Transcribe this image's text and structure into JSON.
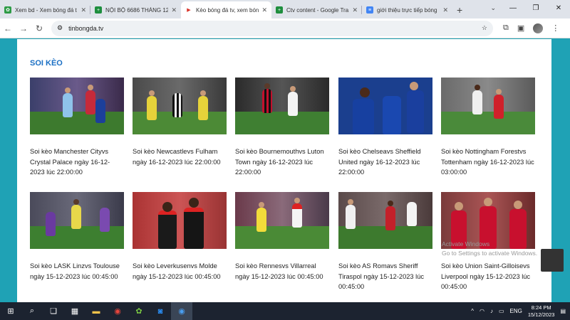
{
  "browser": {
    "tabs": [
      {
        "label": "Xem bd - Xem bóng đá t",
        "icon": "clover-icon",
        "color": "#2e9b46"
      },
      {
        "label": "NỘI BỘ 6686 THÁNG 12",
        "icon": "sheets-icon",
        "color": "#1e8e3e"
      },
      {
        "label": "Kèo bóng đá tv, xem bón",
        "icon": "play-icon",
        "color": "#d93025",
        "active": true
      },
      {
        "label": "Ctv content - Google Tra",
        "icon": "sheets-icon",
        "color": "#1e8e3e"
      },
      {
        "label": "giới thiệu trực tiếp bóng",
        "icon": "docs-icon",
        "color": "#4285f4"
      }
    ],
    "url": "tinbongda.tv"
  },
  "section": {
    "title": "SOI KÈO"
  },
  "cards": [
    {
      "caption": "Soi kèo Manchester Cityvs Crystal Palace ngày 16-12-2023 lúc 22:00:00"
    },
    {
      "caption": "Soi kèo Newcastlevs Fulham ngày 16-12-2023 lúc 22:00:00"
    },
    {
      "caption": "Soi kèo Bournemouthvs Luton Town ngày 16-12-2023 lúc 22:00:00"
    },
    {
      "caption": "Soi kèo Chelseavs Sheffield United ngày 16-12-2023 lúc 22:00:00"
    },
    {
      "caption": "Soi kèo Nottingham Forestvs Tottenham ngày 16-12-2023 lúc 03:00:00"
    },
    {
      "caption": "Soi kèo LASK Linzvs Toulouse ngày 15-12-2023 lúc 00:45:00"
    },
    {
      "caption": "Soi kèo Leverkusenvs Molde ngày 15-12-2023 lúc 00:45:00"
    },
    {
      "caption": "Soi kèo Rennesvs Villarreal ngày 15-12-2023 lúc 00:45:00"
    },
    {
      "caption": "Soi kèo AS Romavs Sheriff Tiraspol ngày 15-12-2023 lúc 00:45:00"
    },
    {
      "caption": "Soi kèo Union Saint-Gilloisevs Liverpool ngày 15-12-2023 lúc 00:45:00"
    }
  ],
  "watermark": {
    "line1": "Activate Windows",
    "line2": "Go to Settings to activate Windows."
  },
  "taskbar": {
    "time": "8:24 PM",
    "date": "15/12/2023",
    "lang": "ENG"
  }
}
